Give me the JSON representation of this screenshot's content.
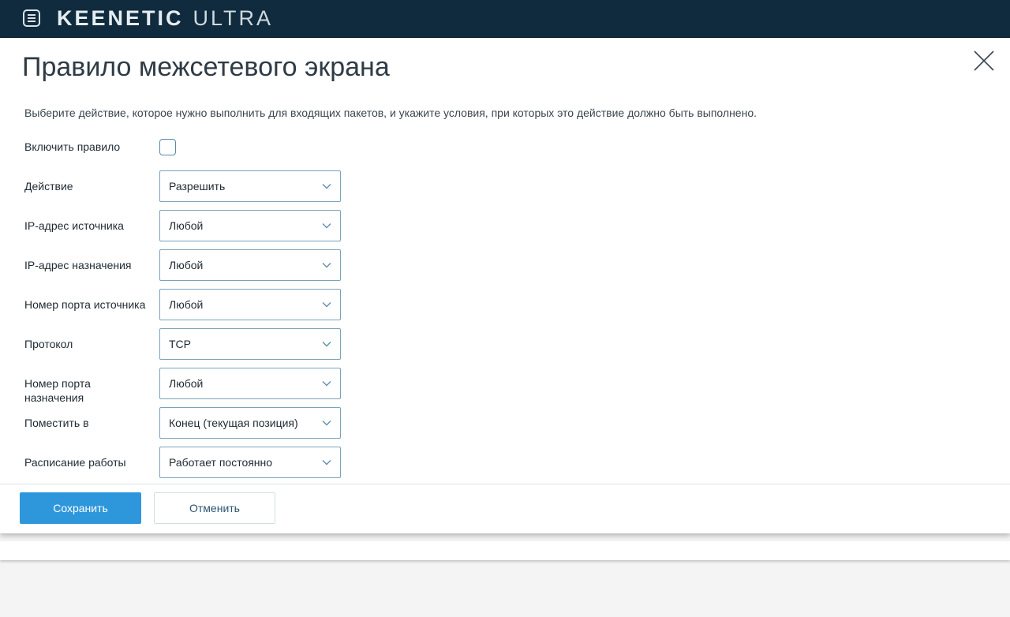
{
  "header": {
    "brand_main": "KEENETIC",
    "brand_model": "ULTRA",
    "menu_icon": "menu-icon",
    "bg_color": "#0f2b3d"
  },
  "dialog": {
    "title": "Правило межсетевого экрана",
    "description": "Выберите действие, которое нужно выполнить для входящих пакетов, и укажите условия, при которых это действие должно быть выполнено.",
    "close_icon": "close-icon",
    "enable": {
      "label": "Включить правило",
      "checked": false
    },
    "fields": [
      {
        "label": "Действие",
        "value": "Разрешить"
      },
      {
        "label": "IP-адрес источника",
        "value": "Любой"
      },
      {
        "label": "IP-адрес назначения",
        "value": "Любой"
      },
      {
        "label": "Номер порта источника",
        "value": "Любой"
      },
      {
        "label": "Протокол",
        "value": "TCP"
      },
      {
        "label": "Номер порта назначения",
        "value": "Любой"
      },
      {
        "label": "Поместить в",
        "value": "Конец (текущая позиция)"
      },
      {
        "label": "Расписание работы",
        "value": "Работает постоянно"
      }
    ],
    "buttons": {
      "save": "Сохранить",
      "cancel": "Отменить"
    },
    "accent_color": "#2e97dc"
  }
}
